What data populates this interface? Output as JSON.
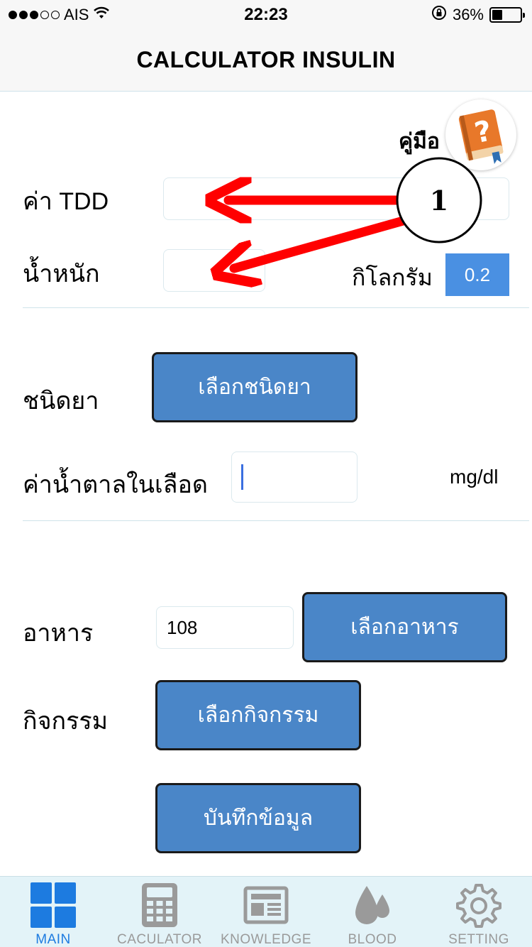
{
  "status_bar": {
    "carrier": "AIS",
    "time": "22:23",
    "battery_percent": "36%",
    "battery_level": 0.36,
    "signal_bars_filled": 3,
    "signal_bars_total": 5
  },
  "navigation": {
    "title": "CALCULATOR INSULIN"
  },
  "guide": {
    "label": "คู่มือ",
    "icon": "help-book-icon"
  },
  "form": {
    "tdd": {
      "label": "ค่า TDD",
      "value": ""
    },
    "weight": {
      "label": "น้ำหนัก",
      "value": "",
      "unit": "กิโลกรัม",
      "factor": "0.2"
    },
    "drug_type": {
      "label": "ชนิดยา",
      "button": "เลือกชนิดยา"
    },
    "blood_sugar": {
      "label": "ค่าน้ำตาลในเลือด",
      "value": "",
      "unit": "mg/dl"
    },
    "food": {
      "label": "อาหาร",
      "value": "108",
      "button": "เลือกอาหาร"
    },
    "activity": {
      "label": "กิจกรรม",
      "button": "เลือกกิจกรรม"
    },
    "save_button": "บันทึกข้อมูล"
  },
  "annotation": {
    "marker_number": "1",
    "arrow_color": "#ff0000"
  },
  "tab_bar": {
    "tabs": [
      {
        "label": "MAIN",
        "icon": "grid-icon",
        "active": true
      },
      {
        "label": "CACULATOR",
        "icon": "calculator-icon",
        "active": false
      },
      {
        "label": "KNOWLEDGE",
        "icon": "newspaper-icon",
        "active": false
      },
      {
        "label": "BLOOD",
        "icon": "blood-drops-icon",
        "active": false
      },
      {
        "label": "SETTING",
        "icon": "gear-icon",
        "active": false
      }
    ]
  },
  "colors": {
    "accent": "#4a86c8",
    "active_tab": "#1d7be0",
    "inactive_tab": "#9a9a9a",
    "tab_bar_bg": "#e3f3f8",
    "badge_bg": "#4a90e2"
  }
}
